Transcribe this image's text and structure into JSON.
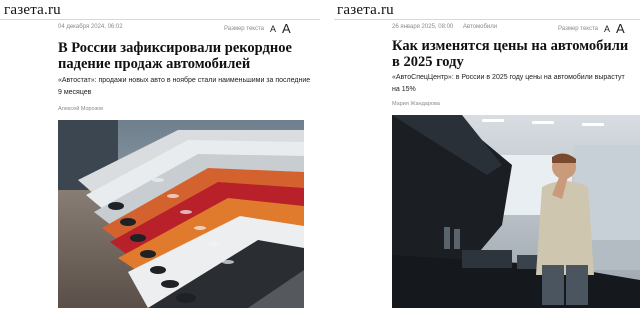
{
  "left": {
    "logo": "газета.ru",
    "date": "04 декабря 2024, 06:02",
    "text_size_label": "Размер текста",
    "text_size_small": "A",
    "text_size_large": "A",
    "title_line1": "В России зафиксировали рекордное",
    "title_line2": "падение продаж автомобилей",
    "lead_line1": "«Автостат»: продажи новых авто в ноябре стали наименьшими за последние",
    "lead_line2": "9 месяцев",
    "author": "Алексей Морозов",
    "photo_subject": "row-of-parked-cars-photo"
  },
  "right": {
    "logo": "газета.ru",
    "date": "26 января 2025, 08:00",
    "category": "Автомобили",
    "text_size_label": "Размер текста",
    "text_size_small": "A",
    "text_size_large": "A",
    "title_line1": "Как изменятся цены на автомобили",
    "title_line2": "в 2025 году",
    "lead_line1": "«АвтоСпецЦентр»: в России в 2025 году цены на автомобили вырастут",
    "lead_line2": "на 15%",
    "author": "Мария Жандарова",
    "photo_subject": "man-inspecting-car-engine-photo"
  }
}
